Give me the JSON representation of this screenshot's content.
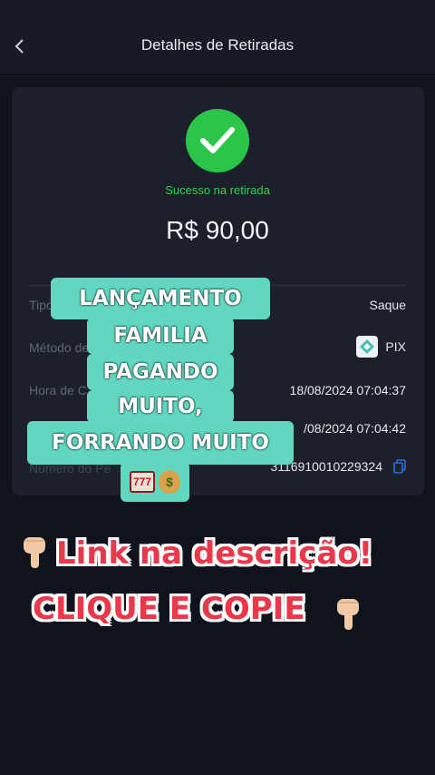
{
  "header": {
    "title": "Detalhes de Retiradas",
    "back_icon": "chevron-left-icon"
  },
  "status": {
    "text": "Sucesso na retirada",
    "color": "#2bc54a"
  },
  "amount": "R$ 90,00",
  "details": {
    "type_label": "Tipo",
    "type_value": "Saque",
    "method_label": "Método de",
    "method_value": "PIX",
    "time_label": "Hora de C",
    "time_value": "18/08/2024 07:04:37",
    "time2_value": "/08/2024 07:04:42",
    "order_label": "Número do Pe",
    "order_value": "3116910010229324"
  },
  "overlay": {
    "lines": [
      "LANÇAMENTO",
      "FAMILIA",
      "PAGANDO",
      "MUITO,",
      "FORRANDO MUITO"
    ],
    "slot_text": "777",
    "bag_text": "$"
  },
  "cta": {
    "line1": "Link na descrição!",
    "line2": "CLIQUE E COPIE"
  }
}
